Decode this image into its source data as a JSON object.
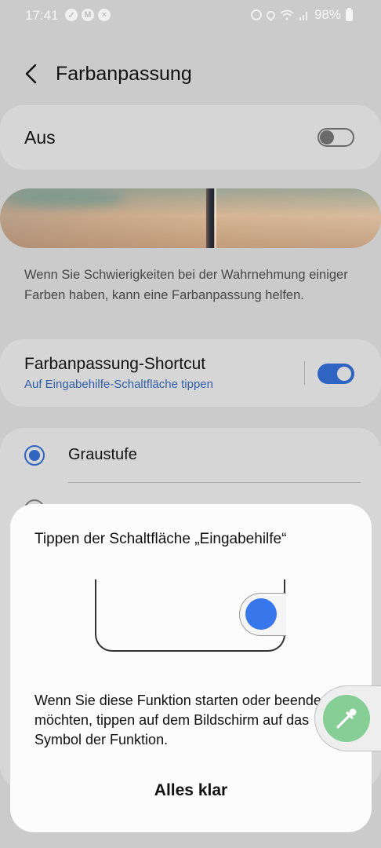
{
  "status_bar": {
    "time": "17:41",
    "battery": "98%",
    "icons_left": [
      "check-circle-icon",
      "gmail-icon",
      "app-icon"
    ],
    "icons_right": [
      "alarm-icon",
      "location-icon",
      "wifi-icon",
      "signal-icon",
      "battery-icon"
    ]
  },
  "header": {
    "title": "Farbanpassung"
  },
  "main_toggle": {
    "label": "Aus",
    "state": "off"
  },
  "description": "Wenn Sie Schwierigkeiten bei der Wahrnehmung einiger Farben haben, kann eine Farbanpassung helfen.",
  "shortcut": {
    "title": "Farbanpassung-Shortcut",
    "subtitle": "Auf Eingabehilfe-Schaltfläche tippen",
    "state": "on"
  },
  "options": [
    {
      "label": "Graustufe",
      "selected": true
    }
  ],
  "dialog": {
    "title": "Tippen der Schaltfläche „Eingabehilfe“",
    "body": "Wenn Sie diese Funktion starten oder beenden möchten, tippen auf dem Bildschirm auf das Symbol der Funktion.",
    "confirm_label": "Alles klar"
  },
  "colors": {
    "accent": "#2f64c0",
    "illustration_dot": "#3876ec",
    "floating_button": "#86ce95"
  }
}
